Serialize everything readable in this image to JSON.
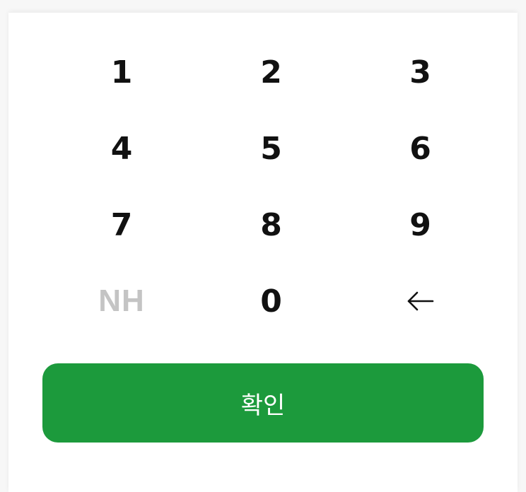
{
  "keypad": {
    "keys": [
      "1",
      "2",
      "3",
      "4",
      "5",
      "6",
      "7",
      "8",
      "9",
      "0"
    ],
    "logo": "NH",
    "backspace_icon": "arrow-left-icon"
  },
  "confirm_button": {
    "label": "확인",
    "color": "#1c9a3c"
  }
}
